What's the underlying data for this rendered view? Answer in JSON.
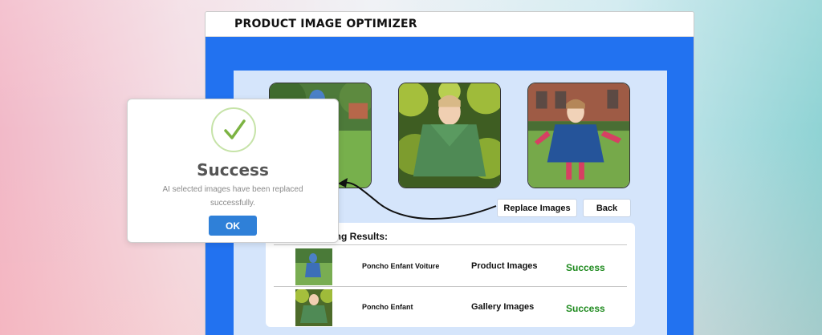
{
  "app": {
    "title": "PRODUCT IMAGE OPTIMIZER"
  },
  "buttons": {
    "replace_images": "Replace Images",
    "back": "Back"
  },
  "results": {
    "title": "Image Processing Results:",
    "title_visible": "ssing Results:",
    "rows": [
      {
        "name": "Poncho Enfant Voiture",
        "type": "Product Images",
        "status": "Success"
      },
      {
        "name": "Poncho Enfant",
        "type": "Gallery Images",
        "status": "Success"
      }
    ]
  },
  "modal": {
    "title": "Success",
    "message_line1": "AI selected images have been replaced",
    "message_line2": "successfully.",
    "ok_label": "OK"
  },
  "colors": {
    "app_blue": "#2272f0",
    "panel_bg": "#d5e5fb",
    "success_green": "#1e8a1e",
    "ok_button": "#2f80d8",
    "check_green": "#8bc34a"
  },
  "icons": {
    "success": "check-icon",
    "thumbnails": [
      "poncho-photo-1",
      "poncho-photo-2",
      "poncho-photo-3"
    ]
  }
}
